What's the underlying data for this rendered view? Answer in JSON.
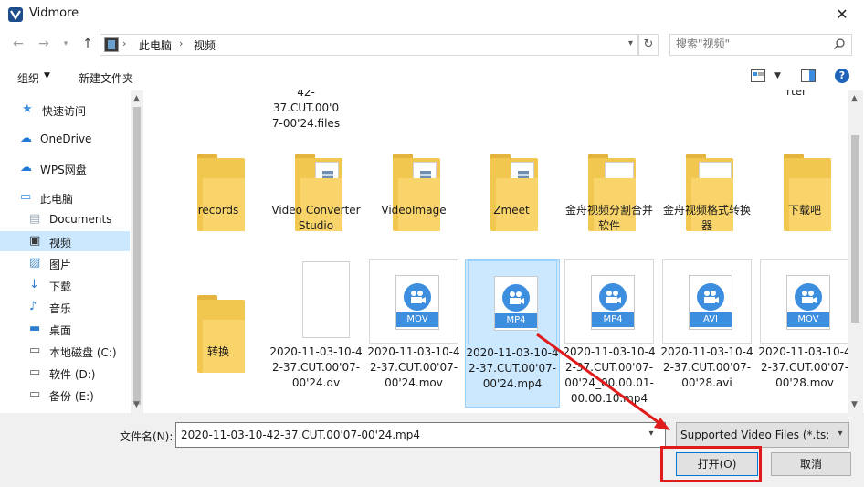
{
  "window": {
    "title": "Vidmore",
    "close_glyph": "✕"
  },
  "address": {
    "crumbs": [
      "此电脑",
      "视频"
    ],
    "separator": "›"
  },
  "search": {
    "placeholder": "搜索\"视频\""
  },
  "toolbar": {
    "organize_label": "组织",
    "new_folder_label": "新建文件夹",
    "help_label": "?"
  },
  "nav": {
    "items": [
      {
        "label": "快速访问",
        "icon": "star-icon"
      },
      {
        "label": "OneDrive",
        "icon": "cloud-icon"
      },
      {
        "label": "WPS网盘",
        "icon": "cloud-icon"
      },
      {
        "label": "此电脑",
        "icon": "computer-icon"
      },
      {
        "label": "Documents",
        "icon": "document-icon"
      },
      {
        "label": "视频",
        "icon": "video-folder-icon",
        "selected": true
      },
      {
        "label": "图片",
        "icon": "picture-icon"
      },
      {
        "label": "下载",
        "icon": "download-icon"
      },
      {
        "label": "音乐",
        "icon": "music-icon"
      },
      {
        "label": "桌面",
        "icon": "desktop-icon"
      },
      {
        "label": "本地磁盘 (C:)",
        "icon": "drive-icon"
      },
      {
        "label": "软件 (D:)",
        "icon": "drive-icon"
      },
      {
        "label": "备份 (E:)",
        "icon": "drive-icon"
      }
    ]
  },
  "files": {
    "partial_top": [
      "42-37.CUT.00'0",
      "7-00'24.files",
      "rter"
    ],
    "row1": [
      {
        "name": "records",
        "kind": "folder"
      },
      {
        "name": "Video Converter Studio",
        "kind": "folder-docs"
      },
      {
        "name": "VideoImage",
        "kind": "folder-docs"
      },
      {
        "name": "Zmeet",
        "kind": "folder-docs"
      },
      {
        "name": "金舟视频分割合并软件",
        "kind": "folder-app"
      },
      {
        "name": "金舟视频格式转换器",
        "kind": "folder-music"
      },
      {
        "name": "下载吧",
        "kind": "folder"
      }
    ],
    "row2": [
      {
        "name": "转换",
        "kind": "folder"
      },
      {
        "name": "2020-11-03-10-42-37.CUT.00'07-00'24.dv",
        "kind": "blank"
      },
      {
        "name": "2020-11-03-10-42-37.CUT.00'07-00'24.mov",
        "kind": "video",
        "badge": "MOV"
      },
      {
        "name": "2020-11-03-10-42-37.CUT.00'07-00'24.mp4",
        "kind": "video",
        "badge": "MP4",
        "selected": true
      },
      {
        "name": "2020-11-03-10-42-37.CUT.00'07-00'24_00.00.01-00.00.10.mp4",
        "kind": "video",
        "badge": "MP4"
      },
      {
        "name": "2020-11-03-10-42-37.CUT.00'07-00'28.avi",
        "kind": "video",
        "badge": "AVI"
      },
      {
        "name": "2020-11-03-10-42-37.CUT.00'07-00'28.mov",
        "kind": "video",
        "badge": "MOV"
      }
    ]
  },
  "bottom": {
    "filename_label": "文件名(N):",
    "filename_value": "2020-11-03-10-42-37.CUT.00'07-00'24.mp4",
    "filter_value": "Supported Video Files (*.ts;",
    "open_label": "打开(O)",
    "cancel_label": "取消"
  },
  "colors": {
    "accent": "#0078d7",
    "selection": "#cce8ff",
    "annotation": "#e01b1b",
    "folder": "#f1c74f"
  }
}
